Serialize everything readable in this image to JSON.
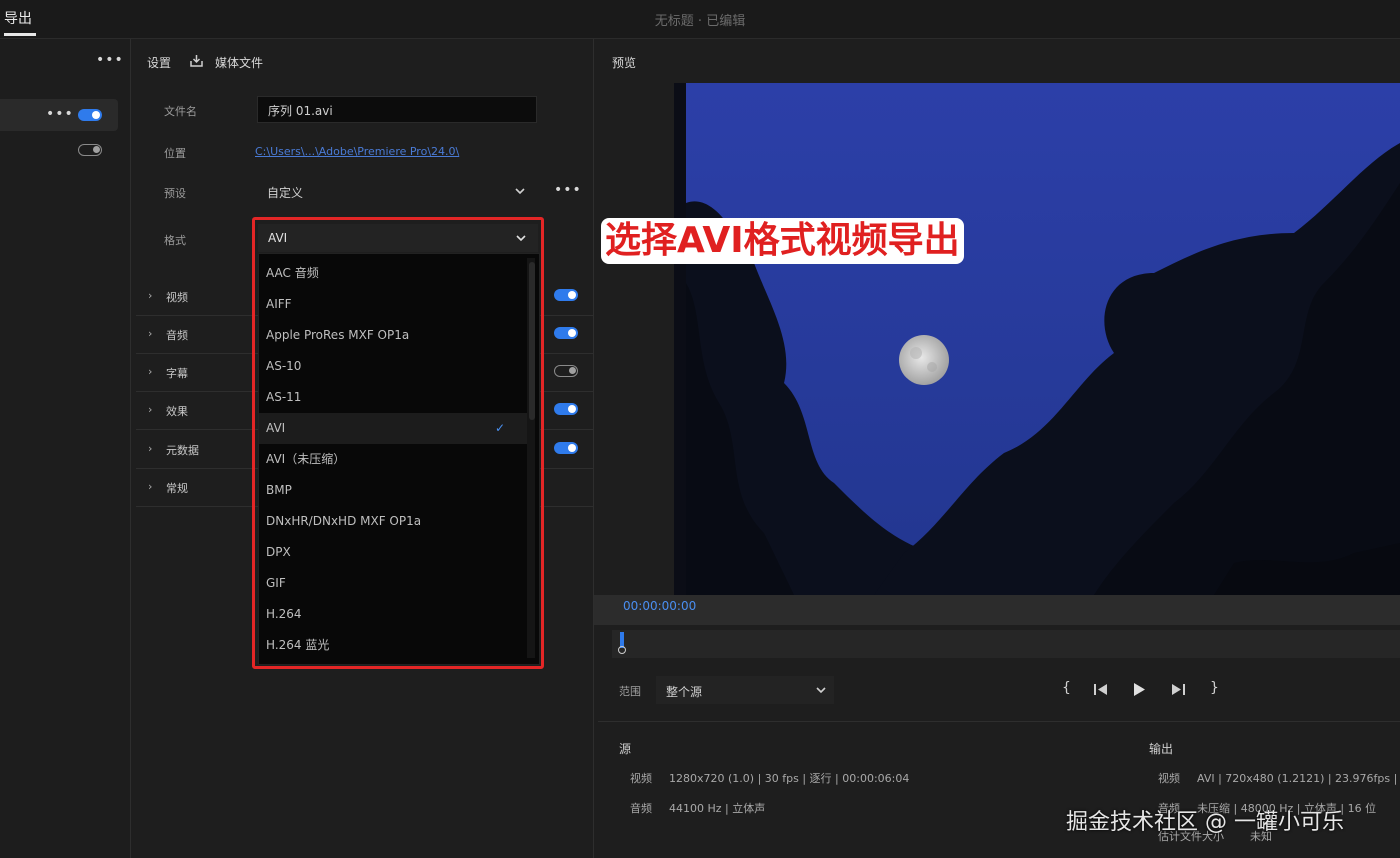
{
  "window": {
    "tab_export": "导出",
    "title": "无标题 · 已编辑"
  },
  "left_panel": {
    "more": "•••"
  },
  "settings": {
    "heading": "设置",
    "media_file_label": "媒体文件",
    "filename_label": "文件名",
    "filename_value": "序列 01.avi",
    "location_label": "位置",
    "location_value": "C:\\Users\\...\\Adobe\\Premiere Pro\\24.0\\",
    "preset_label": "预设",
    "preset_value": "自定义",
    "preset_more": "•••",
    "format_label": "格式",
    "format_value": "AVI"
  },
  "sections": [
    {
      "label": "视频",
      "toggle": "on"
    },
    {
      "label": "音频",
      "toggle": "on"
    },
    {
      "label": "字幕",
      "toggle": "off"
    },
    {
      "label": "效果",
      "toggle": "on"
    },
    {
      "label": "元数据",
      "toggle": "on"
    },
    {
      "label": "常规",
      "toggle": "none"
    }
  ],
  "format_options": [
    "AAC 音频",
    "AIFF",
    "Apple ProRes MXF OP1a",
    "AS-10",
    "AS-11",
    "AVI",
    "AVI（未压缩）",
    "BMP",
    "DNxHR/DNxHD MXF OP1a",
    "DPX",
    "GIF",
    "H.264",
    "H.264 蓝光"
  ],
  "selected_format_index": 5,
  "annotation": "选择AVI格式视频导出",
  "preview": {
    "heading": "预览",
    "timecode": "00:00:00:00",
    "range_label": "范围",
    "range_value": "整个源"
  },
  "source_info": {
    "title": "源",
    "video_label": "视频",
    "video_value": "1280x720 (1.0) | 30 fps | 逐行 | 00:00:06:04",
    "audio_label": "音频",
    "audio_value": "44100 Hz | 立体声"
  },
  "output_info": {
    "title": "输出",
    "video_label": "视频",
    "video_value": "AVI | 720x480 (1.2121) | 23.976fps | 逐",
    "audio_label": "音频",
    "audio_value": "未压缩 | 48000 Hz | 立体声 | 16 位",
    "size_label": "估计文件大小",
    "size_value": "未知"
  },
  "watermark": "掘金技术社区 @ 一罐小可乐",
  "colors": {
    "accent": "#2f7bec",
    "highlight_box": "#e32626",
    "annotation_text": "#e02020"
  }
}
